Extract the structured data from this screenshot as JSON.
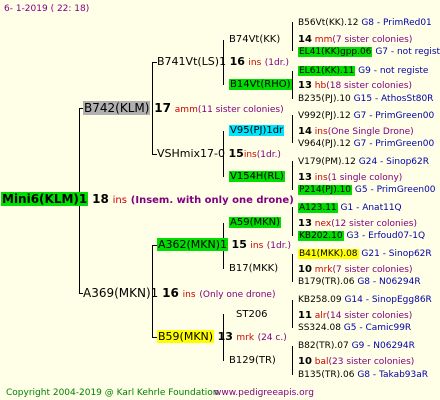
{
  "header": {
    "date": "6-  1-2019 ( 22: 18)"
  },
  "footer": {
    "copyright": "Copyright 2004-2019 @ Karl Kehrle Foundation",
    "site": "www.pedigreeapis.org"
  },
  "root": {
    "name": "Mini6(KLM)1",
    "num": "18",
    "ins": "ins",
    "note": "(Insem. with only one drone)"
  },
  "gen1": [
    {
      "name": "B742(KLM)",
      "num": "17",
      "ins": "amm",
      "note": "(11 sister colonies)"
    },
    {
      "name": "A369(MKN)1",
      "num": "16",
      "ins": "ins",
      "note": "(Only one drone)"
    }
  ],
  "gen2": [
    {
      "name": "B741Vt(LS)1",
      "num": "16",
      "ins": "ins",
      "note": "(1dr.)"
    },
    {
      "name": "VSHmix17-0",
      "num": "15",
      "ins": "ins",
      "note": "(1dr.)"
    },
    {
      "name": "A362(MKN)1",
      "num": "15",
      "ins": "ins",
      "note": "(1dr.)"
    },
    {
      "name": "B59(MKN)",
      "num": "13",
      "ins": "mrk",
      "note": "(24 c.)"
    }
  ],
  "gen3": [
    {
      "name": "B74Vt(KK)",
      "num": "14",
      "ins": "mm",
      "note": "(7 sister colonies)"
    },
    {
      "name": "B14Vt(RHO)",
      "num": "13",
      "ins": "hb",
      "note": "(18 sister colonies)"
    },
    {
      "name": "V95(PJ)1dr",
      "num": "14",
      "ins": "ins",
      "note": "(One Single Drone)"
    },
    {
      "name": "V154H(RL)",
      "num": "13",
      "ins": "ins",
      "note": "(1 single colony)"
    },
    {
      "name": "A59(MKN)",
      "num": "13",
      "ins": "nex",
      "note": "(12 sister colonies)"
    },
    {
      "name": "B17(MKK)",
      "num": "10",
      "ins": "mrk",
      "note": "(7 sister colonies)"
    },
    {
      "name": "ST206",
      "num": "11",
      "ins": "alr",
      "note": "(14 sister colonies)"
    },
    {
      "name": "B129(TR)",
      "num": "10",
      "ins": "bal",
      "note": "(23 sister colonies)"
    }
  ],
  "gen4": [
    {
      "name": "B56Vt(KK).12",
      "ref": "G8 - PrimRed01"
    },
    {
      "name": "EL41(KK)gpp.06",
      "ref": "G7 - not registe"
    },
    {
      "name": "EL61(KK).11",
      "ref": "G9 - not registe"
    },
    {
      "name": "B235(PJ).10",
      "ref": "G15 - AthosSt80R"
    },
    {
      "name": "V992(PJ).12",
      "ref": "G7 - PrimGreen00"
    },
    {
      "name": "V964(PJ).12",
      "ref": "G7 - PrimGreen00"
    },
    {
      "name": "V179(PM).12",
      "ref": "G24 - Sinop62R"
    },
    {
      "name": "P214(PJ).10",
      "ref": "G5 - PrimGreen00"
    },
    {
      "name": "A123.11",
      "ref": "G1 - Anat11Q"
    },
    {
      "name": "KB202.10",
      "ref": "G3 - Erfoud07-1Q"
    },
    {
      "name": "B41(MKK).08",
      "ref": "G21 - Sinop62R"
    },
    {
      "name": "B179(TR).06",
      "ref": "G8 - N06294R"
    },
    {
      "name": "KB258.09",
      "ref": "G14 - SinopEgg86R"
    },
    {
      "name": "SS324.08",
      "ref": "G5 - Camic99R"
    },
    {
      "name": "B82(TR).07",
      "ref": "G9 - N06294R"
    },
    {
      "name": "B135(TR).06",
      "ref": "G8 - Takab93aR"
    }
  ],
  "colors": {
    "background": "#ffffe8",
    "green": "#00dd00",
    "cyan": "#00e5ff",
    "yellow": "#ffff00",
    "magenta": "#ff00ff",
    "gray": "#b0b0b0"
  }
}
